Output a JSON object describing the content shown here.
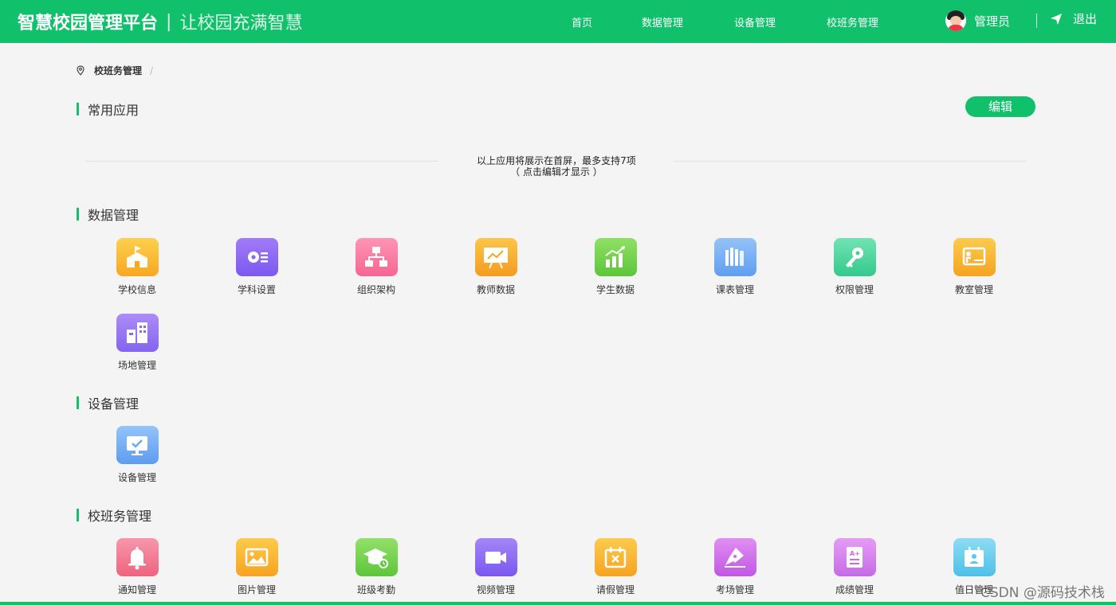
{
  "header": {
    "title": "智慧校园管理平台",
    "separator": "|",
    "slogan": "让校园充满智慧",
    "nav": [
      "首页",
      "数据管理",
      "设备管理",
      "校班务管理"
    ],
    "user_name": "管理员",
    "logout_label": "退出"
  },
  "breadcrumb": {
    "current": "校班务管理",
    "separator": "/"
  },
  "common_apps": {
    "title": "常用应用",
    "edit_label": "编辑",
    "hint_line1": "以上应用将展示在首屏，最多支持7项",
    "hint_line2": "（ 点击编辑才显示 ）"
  },
  "sections": {
    "data": {
      "title": "数据管理",
      "apps": [
        "学校信息",
        "学科设置",
        "组织架构",
        "教师数据",
        "学生数据",
        "课表管理",
        "权限管理",
        "教室管理",
        "场地管理"
      ]
    },
    "device": {
      "title": "设备管理",
      "apps": [
        "设备管理"
      ]
    },
    "class": {
      "title": "校班务管理",
      "apps": [
        "通知管理",
        "图片管理",
        "班级考勤",
        "视频管理",
        "请假管理",
        "考场管理",
        "成绩管理",
        "值日管理"
      ]
    }
  },
  "watermark": "CSDN @源码技术栈",
  "colors": {
    "brand_green": "#10c06a",
    "school_info": "#fbb832",
    "subject": "#8b68f4",
    "org": "#fb7aa0",
    "teacher": "#f9a825",
    "student": "#6dd34c",
    "timetable": "#7cb3f5",
    "permission": "#4cd7a0",
    "classroom": "#f8b730",
    "venue": "#9b78f2",
    "device": "#6eb0f4",
    "notice": "#f27b93",
    "picture": "#f7b530",
    "attendance": "#7ad248",
    "video": "#8c6bf3",
    "leave": "#f7b530",
    "exam": "#cc6ae8",
    "score": "#d079ec",
    "duty": "#66cfee"
  }
}
